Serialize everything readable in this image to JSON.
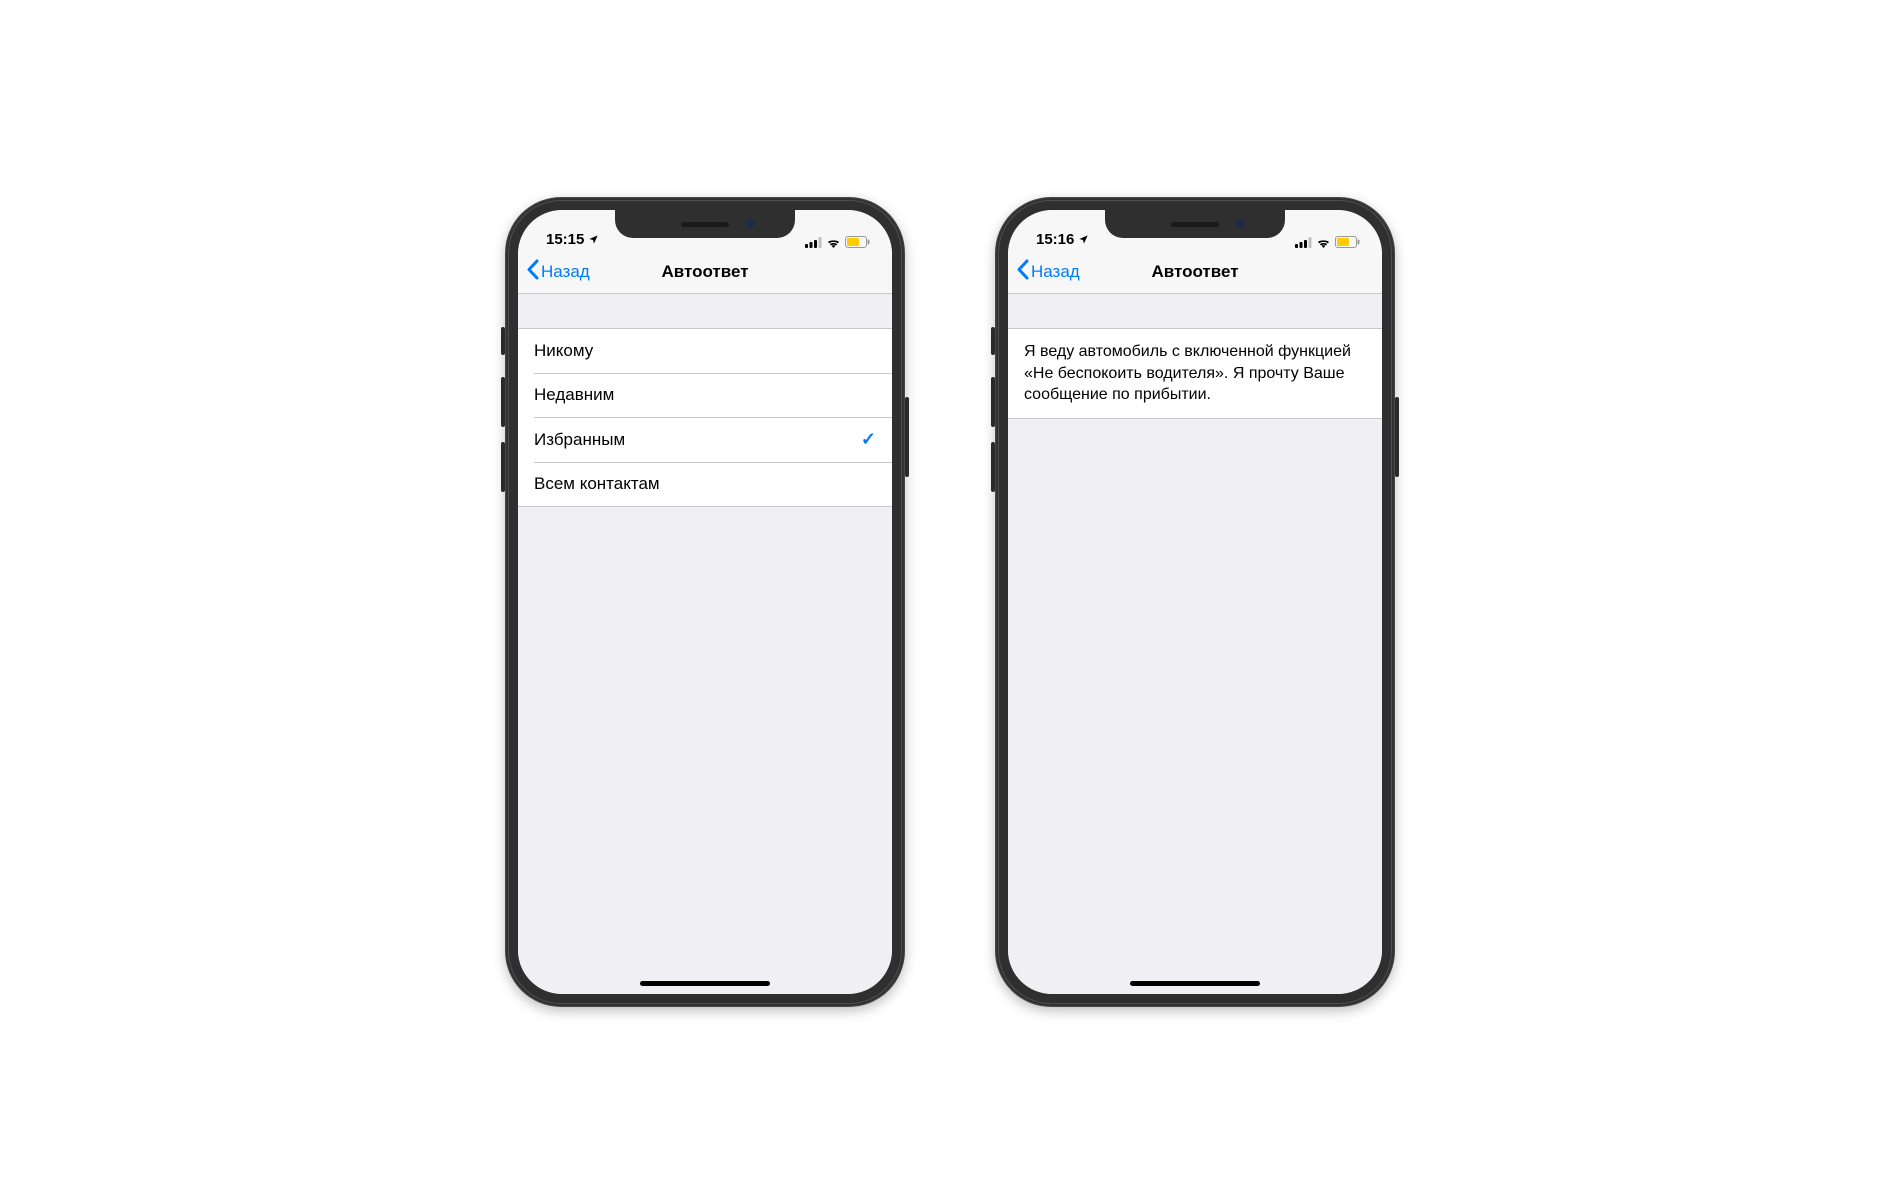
{
  "left_phone": {
    "status": {
      "time": "15:15"
    },
    "nav": {
      "back": "Назад",
      "title": "Автоответ"
    },
    "options": [
      {
        "label": "Никому",
        "selected": false
      },
      {
        "label": "Недавним",
        "selected": false
      },
      {
        "label": "Избранным",
        "selected": true
      },
      {
        "label": "Всем контактам",
        "selected": false
      }
    ]
  },
  "right_phone": {
    "status": {
      "time": "15:16"
    },
    "nav": {
      "back": "Назад",
      "title": "Автоответ"
    },
    "message": "Я веду автомобиль с включенной функцией «Не беспокоить водителя». Я прочту Ваше сообщение по прибытии."
  },
  "checkmark": "✓"
}
